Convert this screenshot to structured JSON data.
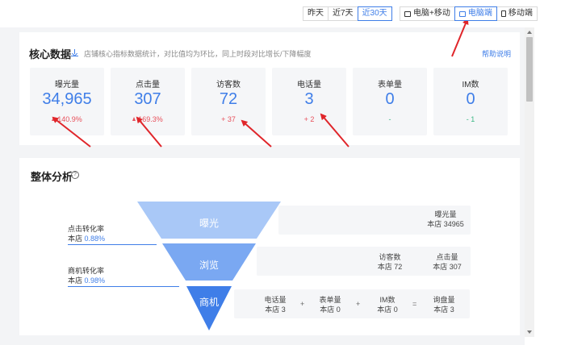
{
  "toolbar": {
    "date_range": [
      {
        "label": "昨天",
        "active": false
      },
      {
        "label": "近7天",
        "active": false
      },
      {
        "label": "近30天",
        "active": true
      }
    ],
    "device": [
      {
        "label": "电脑+移动",
        "icon": "pc-mobile-icon",
        "active": false
      },
      {
        "label": "电脑端",
        "icon": "monitor-icon",
        "active": true
      },
      {
        "label": "移动端",
        "icon": "phone-icon",
        "active": false
      }
    ]
  },
  "core": {
    "title": "核心数据",
    "subtitle": "店铺核心指标数据统计，对比值均为环比，同上时段对比增长/下降幅度",
    "help": "帮助说明",
    "metrics": [
      {
        "label": "曝光量",
        "value": "34,965",
        "change": "140.9%",
        "trend": "up"
      },
      {
        "label": "点击量",
        "value": "307",
        "change": "169.3%",
        "trend": "up"
      },
      {
        "label": "访客数",
        "value": "72",
        "change": "+ 37",
        "trend": "up"
      },
      {
        "label": "电话量",
        "value": "3",
        "change": "+ 2",
        "trend": "up"
      },
      {
        "label": "表单量",
        "value": "0",
        "change": "-",
        "trend": "flat"
      },
      {
        "label": "IM数",
        "value": "0",
        "change": "- 1",
        "trend": "flat"
      }
    ]
  },
  "analysis": {
    "title": "整体分析",
    "funnel": [
      {
        "label": "曝光"
      },
      {
        "label": "浏览"
      },
      {
        "label": "商机"
      }
    ],
    "conversions": [
      {
        "name": "点击转化率",
        "prefix": "本店",
        "value": "0.88%"
      },
      {
        "name": "商机转化率",
        "prefix": "本店",
        "value": "0.98%"
      }
    ],
    "stats": {
      "exposure": {
        "name": "曝光量",
        "value": "本店 34965"
      },
      "visitors": {
        "name": "访客数",
        "value": "本店 72"
      },
      "clicks": {
        "name": "点击量",
        "value": "本店 307"
      },
      "calls": {
        "name": "电话量",
        "value": "本店 3"
      },
      "forms": {
        "name": "表单量",
        "value": "本店 0"
      },
      "im": {
        "name": "IM数",
        "value": "本店 0"
      },
      "inquiries": {
        "name": "询盘量",
        "value": "本店 3"
      }
    },
    "operators": {
      "plus": "+",
      "equals": "="
    }
  },
  "colors": {
    "accent": "#3f7ee8",
    "up": "#e8505b",
    "flat": "#39b784",
    "funnel": [
      "#a9c8f7",
      "#7aa8f2",
      "#3f7ee8"
    ],
    "annotation_arrow": "#e0252a"
  }
}
